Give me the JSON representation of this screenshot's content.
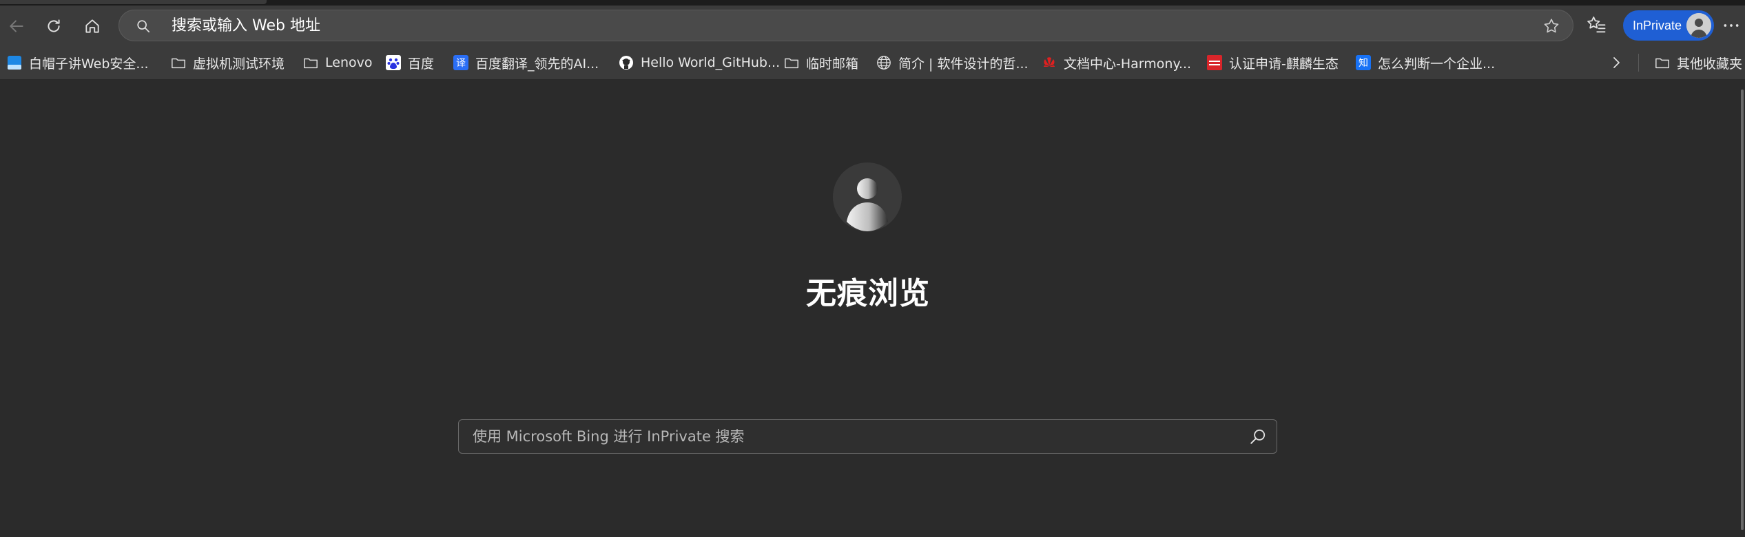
{
  "toolbar": {
    "address_text": "搜索或输入 Web 地址",
    "inprivate_label": "InPrivate"
  },
  "bookmarks": [
    {
      "label": "白帽子讲Web安全...",
      "icon": "blue-square-icon"
    },
    {
      "label": "虚拟机测试环境",
      "icon": "folder-icon"
    },
    {
      "label": "Lenovo",
      "icon": "folder-icon"
    },
    {
      "label": "百度",
      "icon": "baidu-icon"
    },
    {
      "label": "百度翻译_领先的AI...",
      "icon": "translate-icon"
    },
    {
      "label": "Hello World_GitHub...",
      "icon": "github-icon"
    },
    {
      "label": "临时邮箱",
      "icon": "folder-icon"
    },
    {
      "label": "简介 | 软件设计的哲...",
      "icon": "globe-icon"
    },
    {
      "label": "文档中心-Harmony...",
      "icon": "huawei-icon"
    },
    {
      "label": "认证申请-麒麟生态",
      "icon": "kylin-icon"
    },
    {
      "label": "怎么判断一个企业...",
      "icon": "zhihu-icon"
    }
  ],
  "other_bookmarks": "其他收藏夹",
  "main": {
    "title": "无痕浏览",
    "search_placeholder": "使用 Microsoft Bing 进行 InPrivate 搜索"
  },
  "icon_text": {
    "translate": "译",
    "zhihu": "知"
  },
  "colors": {
    "background": "#2b2b2b",
    "toolbar": "#3b3b3b",
    "inprivate_accent": "#1f5fd4"
  }
}
